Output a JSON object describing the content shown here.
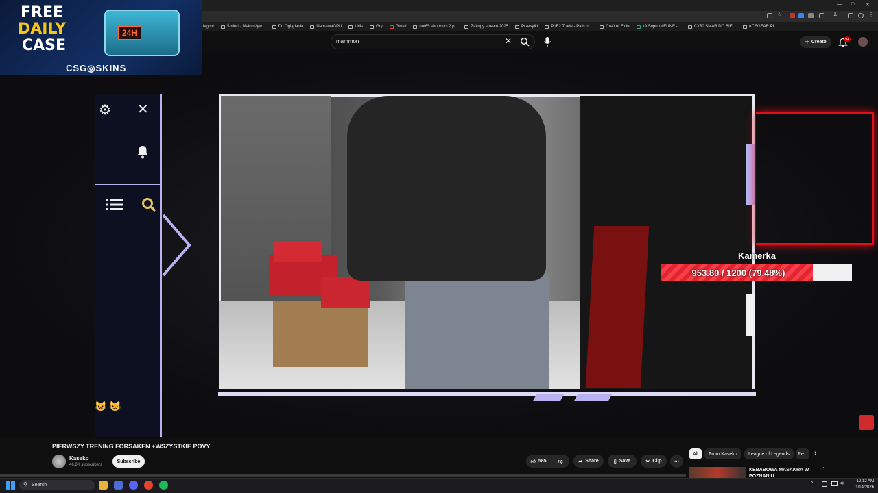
{
  "browser": {
    "bookmarks": [
      "Śmieci / Mało używ...",
      "Do Oglądania",
      "NaprawaGPU",
      "Utils",
      "Gry",
      "Gmail",
      "nut65 shortcuts 2.p...",
      "Zakupy stream 2025",
      "Przesyłki",
      "PoE2 Trade - Path of...",
      "Craft of Exile",
      "x9 Suport #EUNE -...",
      "CX80 SMAR DO BIE...",
      "ACEGEAR.PL"
    ],
    "first_bookmark_partial": "legimi"
  },
  "ad": {
    "line1": "FREE",
    "line2": "DAILY",
    "line3": "CASE",
    "timer": "24H",
    "brand": "CSG◎SKINS"
  },
  "header": {
    "search_value": "mammon",
    "create_label": "Create",
    "notification_badge": "9+"
  },
  "overlay": {
    "label": "Kamerka",
    "progress_text": "953.80 / 1200 (79.48%)",
    "progress_fraction": 0.7948,
    "accent_color": "#e3232f",
    "frame_color": "#b9b2f0"
  },
  "video": {
    "title": "PIERWSZY TRENING FORSAKEN +WSZYSTKIE POVY",
    "channel": "Kaseko",
    "subscribers": "46.8K subscribers",
    "subscribe_label": "Subscribe",
    "likes": "585",
    "share_label": "Share",
    "save_label": "Save",
    "clip_label": "Clip"
  },
  "chips": [
    "All",
    "From Kaseko",
    "League of Legends",
    "Re"
  ],
  "recommendation": {
    "title": "KEBABOWA MASAKRA W POZNANIU"
  },
  "taskbar": {
    "search_label": "Search",
    "time": "12:12 AM",
    "date": "1/14/2026"
  }
}
